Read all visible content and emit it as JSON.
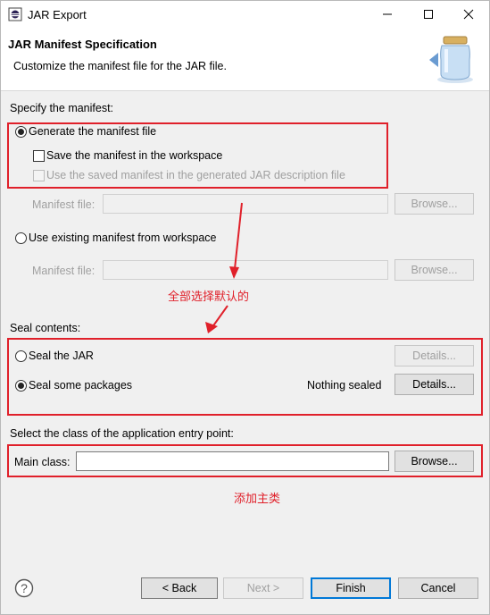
{
  "window": {
    "title": "JAR Export",
    "minimize": "—",
    "maximize": "☐",
    "close": "✕"
  },
  "header": {
    "title": "JAR Manifest Specification",
    "description": "Customize the manifest file for the JAR file."
  },
  "manifest": {
    "section_label": "Specify the manifest:",
    "generate_label": "Generate the manifest file",
    "save_label": "Save the manifest in the workspace",
    "use_saved_label": "Use the saved manifest in the generated JAR description file",
    "manifest_file_label": "Manifest file:",
    "manifest_file_value": "",
    "browse_label": "Browse...",
    "use_existing_label": "Use existing manifest from workspace",
    "manifest_file2_label": "Manifest file:",
    "manifest_file2_value": "",
    "browse2_label": "Browse..."
  },
  "annotation_1": "全部选择默认的",
  "seal": {
    "section_label": "Seal contents:",
    "seal_jar_label": "Seal the JAR",
    "seal_jar_details": "Details...",
    "seal_some_label": "Seal some packages",
    "status": "Nothing sealed",
    "seal_some_details": "Details..."
  },
  "entry": {
    "section_label": "Select the class of the application entry point:",
    "main_class_label": "Main class:",
    "main_class_value": "",
    "browse_label": "Browse..."
  },
  "annotation_2": "添加主类",
  "footer": {
    "help": "?",
    "back": "< Back",
    "next": "Next >",
    "finish": "Finish",
    "cancel": "Cancel"
  },
  "colors": {
    "annotation": "#e0202a",
    "focus": "#0078d7"
  }
}
